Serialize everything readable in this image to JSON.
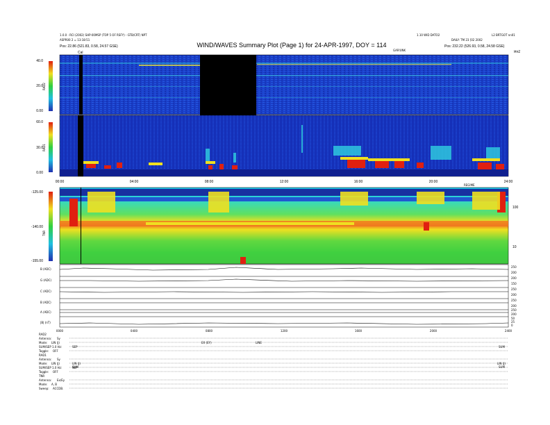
{
  "header": {
    "title": "WIND/WAVES Summary Plot (Page 1) for 24-APR-1997, DOY = 114",
    "left_line1": "1.0.0 - RCI (2002) SHP-00MSP (TOP 5 OF RSFY) - GTB/CRT) NPT",
    "left_line2": "ASPR00 2 = 13:18:51",
    "left_line3": "Pos:   22.86 (521.83, 0.58, 24.57 GSE)",
    "mid_line": "1.10 WID DATO2",
    "right_line1": "L2 BRTGOT nn01",
    "right_line2": "DAILY: TM 23 [02 2002",
    "right_line3": "Pos:   232.22 (526.93, 0.58, 24.58 GSE)",
    "cal_label": "Cal",
    "ticks_right_top": "MHZ",
    "ticks_right_top2": "GAP/UNK"
  },
  "chart_data": [
    {
      "type": "heatmap",
      "name": "RAD2",
      "ylabel": "RAD2",
      "y_ticks": [
        "40.0",
        "20.0",
        "0.00"
      ],
      "ylim": [
        0,
        40
      ]
    },
    {
      "type": "heatmap",
      "name": "RAD1",
      "ylabel": "RAD1",
      "y_ticks": [
        "60.0",
        "30.0",
        "0.00"
      ],
      "ylim": [
        0,
        60
      ]
    },
    {
      "type": "heatmap",
      "name": "TNR",
      "ylabel": "TNR",
      "y_ticks": [
        "-125.00",
        "-140.00",
        "-155.00"
      ],
      "y_ticks_right": [
        "100",
        "10"
      ],
      "ylim": [
        -155,
        -125
      ]
    },
    {
      "type": "line",
      "name": "analog channels",
      "channels": [
        {
          "label": "B (ADC)",
          "ticks": [
            "250",
            "200"
          ]
        },
        {
          "label": "G (ADC)",
          "ticks": [
            "200",
            "150"
          ]
        },
        {
          "label": "C (ADC)",
          "ticks": [
            "250",
            "200"
          ]
        },
        {
          "label": "B (ADC)",
          "ticks": [
            "250",
            "200"
          ]
        },
        {
          "label": "A (ADC)",
          "ticks": [
            "250",
            "200"
          ]
        },
        {
          "label": "|B| (nT)",
          "ticks": [
            "50",
            "25",
            "0"
          ]
        }
      ]
    }
  ],
  "time_axis": {
    "ticks": [
      "00:00",
      "04:00",
      "08:00",
      "12:00",
      "16:00",
      "20:00",
      "24:00"
    ],
    "bottom_ticks": [
      "0000",
      "0400",
      "0800",
      "1200",
      "1600",
      "2000",
      "2400"
    ],
    "right_label": "REGIME"
  },
  "status": {
    "rad2": [
      {
        "label": "RAD2",
        "value": ""
      },
      {
        "label": "Antenna:",
        "value": "Sy"
      },
      {
        "label": "Mode:",
        "value": "LIN   (J)"
      },
      {
        "label": "SUM/SEP 1.0 Hz:",
        "value": "SEP"
      },
      {
        "label": "Toggle:",
        "value": "OFF"
      }
    ],
    "rad1": [
      {
        "label": "RAD1",
        "value": ""
      },
      {
        "label": "Antenna:",
        "value": "Sy"
      },
      {
        "label": "Mode:",
        "value": "LIN   (J)"
      },
      {
        "label": "SUM/SEP 1.0 Hz:",
        "value": "SEP"
      },
      {
        "label": "Toggle:",
        "value": "OFF"
      }
    ],
    "tnr": [
      {
        "label": "TNR",
        "value": ""
      },
      {
        "label": "Antenna:",
        "value": "Ex/Ey"
      },
      {
        "label": "Mode:",
        "value": "A, B"
      },
      {
        "label": "Sweep:",
        "value": "ACCDB."
      }
    ],
    "rad2_markers": [
      "EX (EY)",
      "LINE",
      "SUM"
    ],
    "rad1_markers": [
      "LIN (J)",
      "SUM",
      "LIN (J)",
      "SUM"
    ]
  },
  "colors": {
    "bg_blue": "#1438c8",
    "black": "#000000",
    "red": "#e01010",
    "green": "#20d040",
    "cyan": "#20c8e0"
  }
}
